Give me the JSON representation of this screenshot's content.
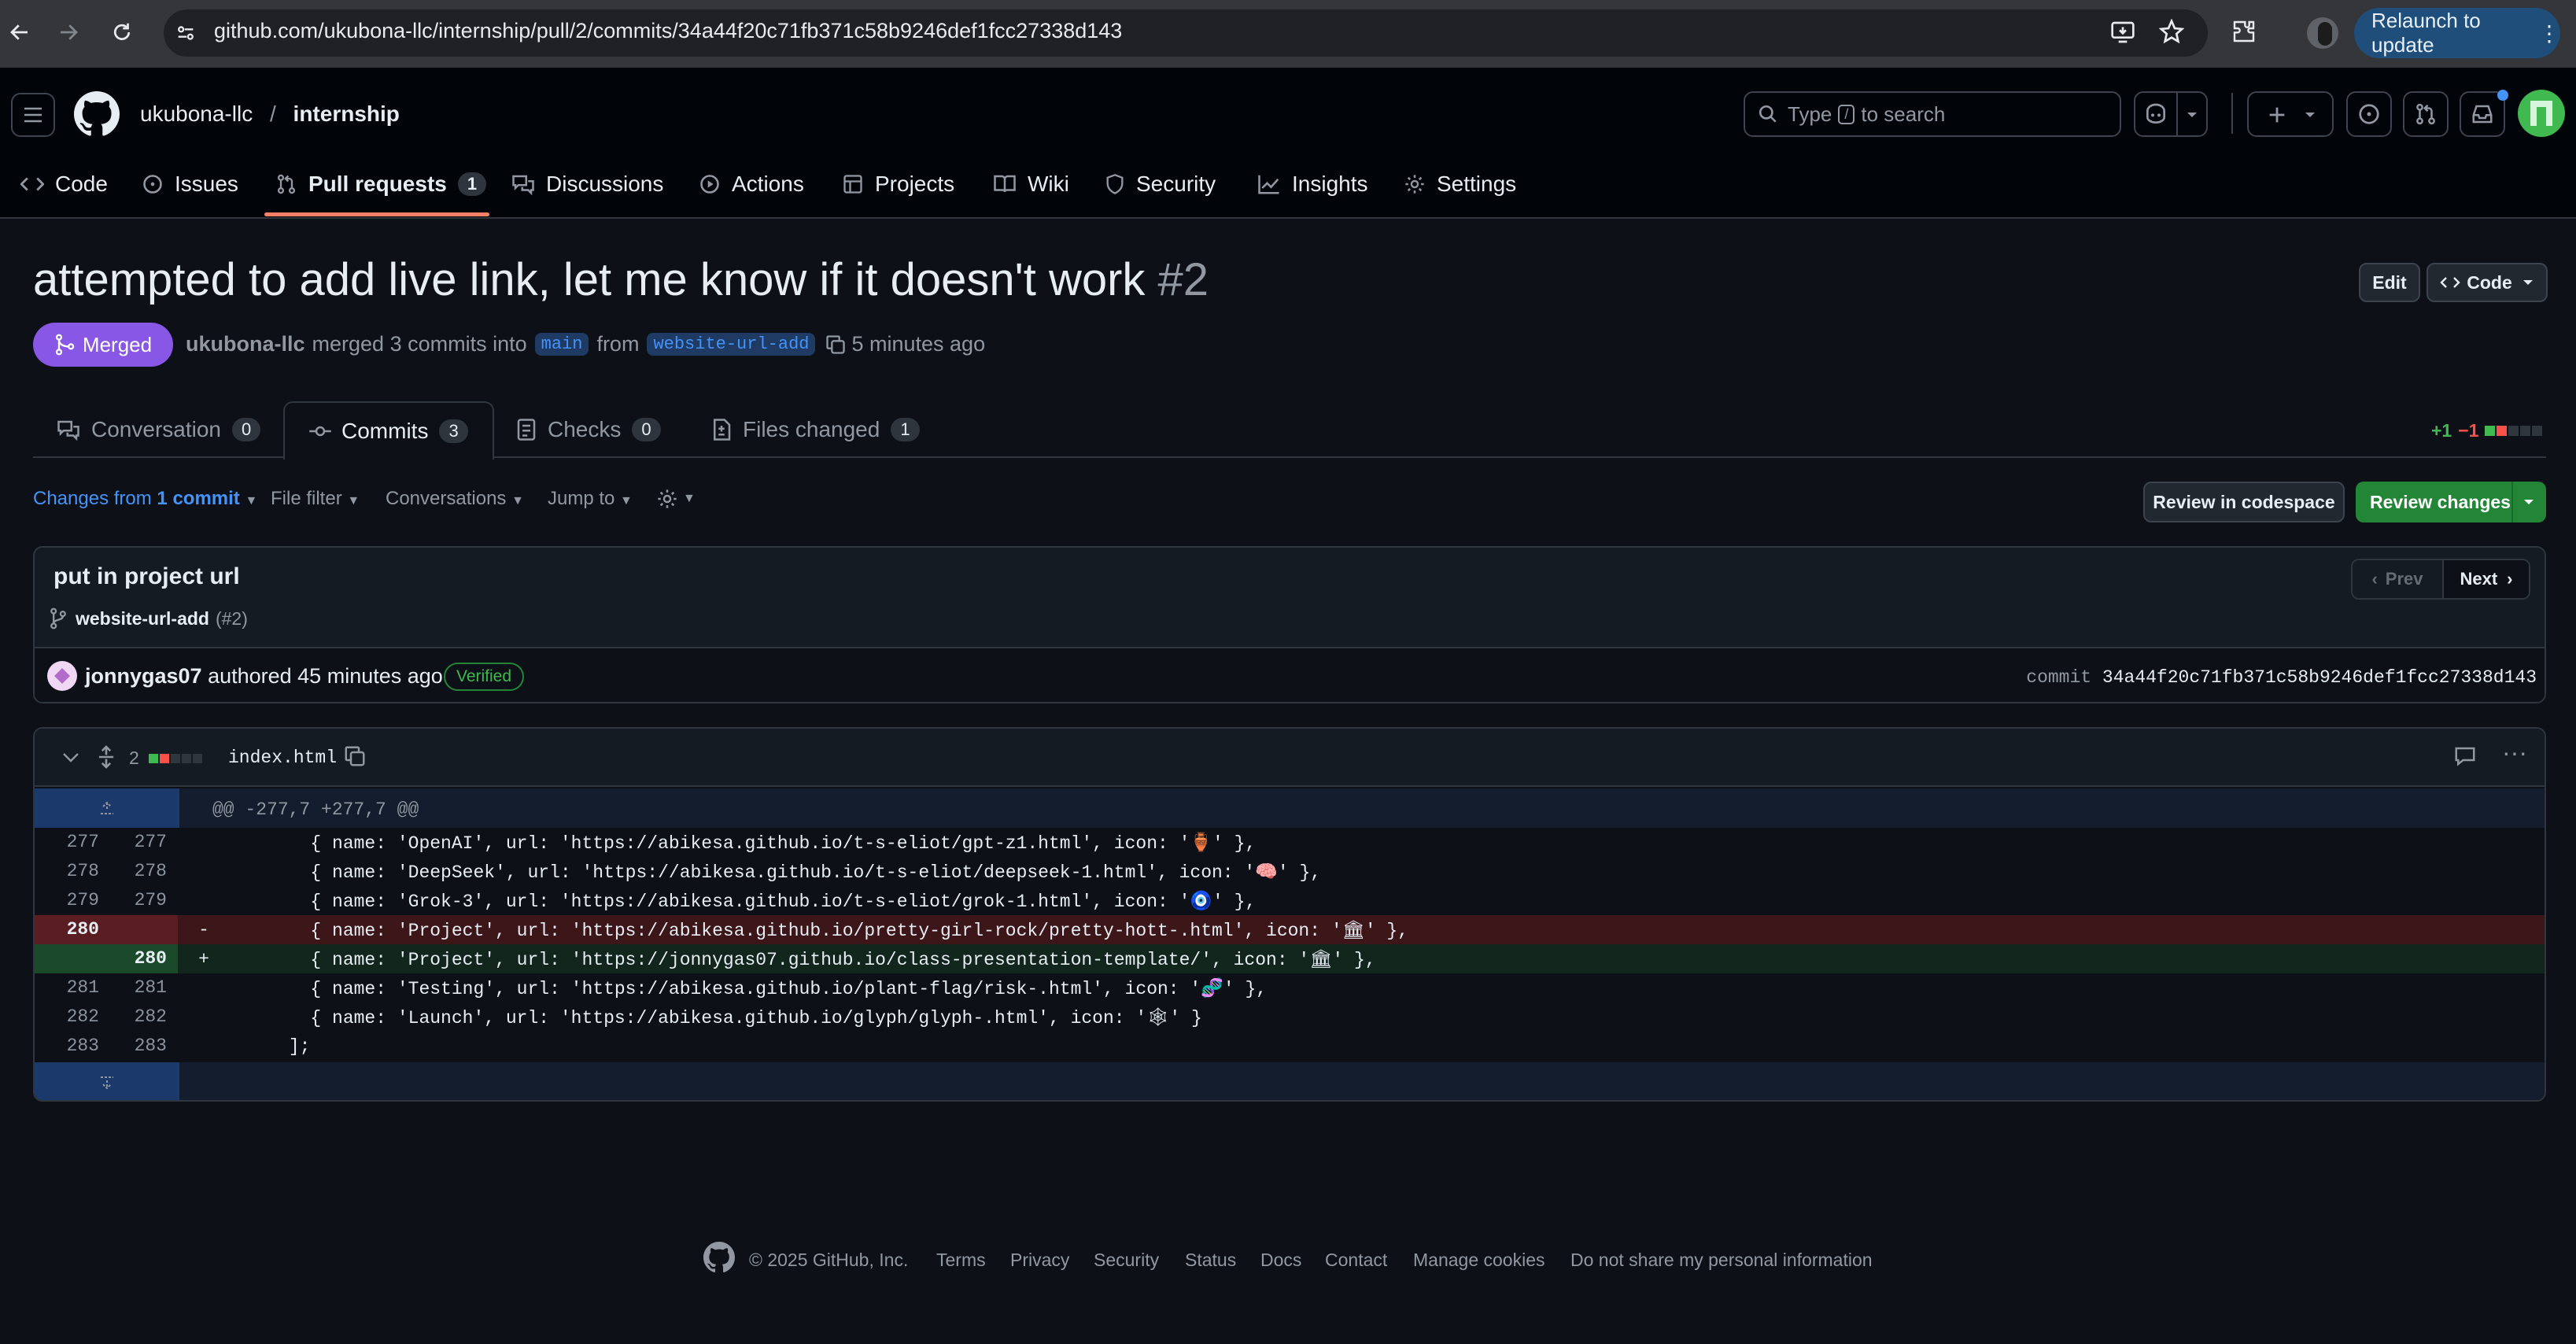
{
  "browser": {
    "url": "github.com/ukubona-llc/internship/pull/2/commits/34a44f20c71fb371c58b9246def1fcc27338d143",
    "relaunch_label": "Relaunch to update"
  },
  "header": {
    "owner": "ukubona-llc",
    "separator": "/",
    "repo": "internship",
    "search_prefix": "Type",
    "search_key": "/",
    "search_suffix": "to search"
  },
  "repo_nav": {
    "items": [
      {
        "label": "Code"
      },
      {
        "label": "Issues"
      },
      {
        "label": "Pull requests",
        "count": "1"
      },
      {
        "label": "Discussions"
      },
      {
        "label": "Actions"
      },
      {
        "label": "Projects"
      },
      {
        "label": "Wiki"
      },
      {
        "label": "Security"
      },
      {
        "label": "Insights"
      },
      {
        "label": "Settings"
      }
    ]
  },
  "pr": {
    "title": "attempted to add live link, let me know if it doesn't work",
    "number": "#2",
    "state": "Merged",
    "author": "ukubona-llc",
    "merged_text": "merged 3 commits into",
    "base": "main",
    "from_text": "from",
    "head": "website-url-add",
    "time": "5 minutes ago",
    "edit_label": "Edit",
    "code_label": "Code"
  },
  "pr_tabs": [
    {
      "label": "Conversation",
      "count": "0"
    },
    {
      "label": "Commits",
      "count": "3"
    },
    {
      "label": "Checks",
      "count": "0"
    },
    {
      "label": "Files changed",
      "count": "1"
    }
  ],
  "diffstat": {
    "added": "+1",
    "removed": "−1"
  },
  "filters": {
    "changes_prefix": "Changes from",
    "changes_value": "1 commit",
    "file_filter": "File filter",
    "conversations": "Conversations",
    "jump_to": "Jump to"
  },
  "review": {
    "codespace_label": "Review in codespace",
    "changes_label": "Review changes"
  },
  "commit": {
    "message": "put in project url",
    "branch": "website-url-add",
    "branch_ref": "(#2)",
    "prev_label": "Prev",
    "next_label": "Next",
    "author": "jonnygas07",
    "authored_text": "authored 45 minutes ago",
    "verified_label": "Verified",
    "commit_label": "commit",
    "sha": "34a44f20c71fb371c58b9246def1fcc27338d143"
  },
  "file": {
    "changes": "2",
    "name": "index.html",
    "hunk_header": "@@ -277,7 +277,7 @@"
  },
  "diff_lines": [
    {
      "old": "277",
      "new": "277",
      "sign": "",
      "type": "context",
      "text": "        { name: 'OpenAI', url: 'https://abikesa.github.io/t-s-eliot/gpt-z1.html', icon: '🏺' },"
    },
    {
      "old": "278",
      "new": "278",
      "sign": "",
      "type": "context",
      "text": "        { name: 'DeepSeek', url: 'https://abikesa.github.io/t-s-eliot/deepseek-1.html', icon: '🧠' },"
    },
    {
      "old": "279",
      "new": "279",
      "sign": "",
      "type": "context",
      "text": "        { name: 'Grok-3', url: 'https://abikesa.github.io/t-s-eliot/grok-1.html', icon: '🧿' },"
    },
    {
      "old": "280",
      "new": "",
      "sign": "-",
      "type": "del",
      "text": "        { name: 'Project', url: 'https://abikesa.github.io/pretty-girl-rock/pretty-hott-.html', icon: '🏛' },"
    },
    {
      "old": "",
      "new": "280",
      "sign": "+",
      "type": "add",
      "text": "        { name: 'Project', url: 'https://jonnygas07.github.io/class-presentation-template/', icon: '🏛' },"
    },
    {
      "old": "281",
      "new": "281",
      "sign": "",
      "type": "context",
      "text": "        { name: 'Testing', url: 'https://abikesa.github.io/plant-flag/risk-.html', icon: '🧬' },"
    },
    {
      "old": "282",
      "new": "282",
      "sign": "",
      "type": "context",
      "text": "        { name: 'Launch', url: 'https://abikesa.github.io/glyph/glyph-.html', icon: '🕸' }"
    },
    {
      "old": "283",
      "new": "283",
      "sign": "",
      "type": "context",
      "text": "      ];"
    }
  ],
  "footer": {
    "copyright": "© 2025 GitHub, Inc.",
    "links": [
      "Terms",
      "Privacy",
      "Security",
      "Status",
      "Docs",
      "Contact",
      "Manage cookies",
      "Do not share my personal information"
    ]
  },
  "colors": {
    "merged": "#8957e5",
    "success": "#238636",
    "accent": "#4493f8",
    "del_bg": "#3c1618",
    "add_bg": "#12261e"
  }
}
